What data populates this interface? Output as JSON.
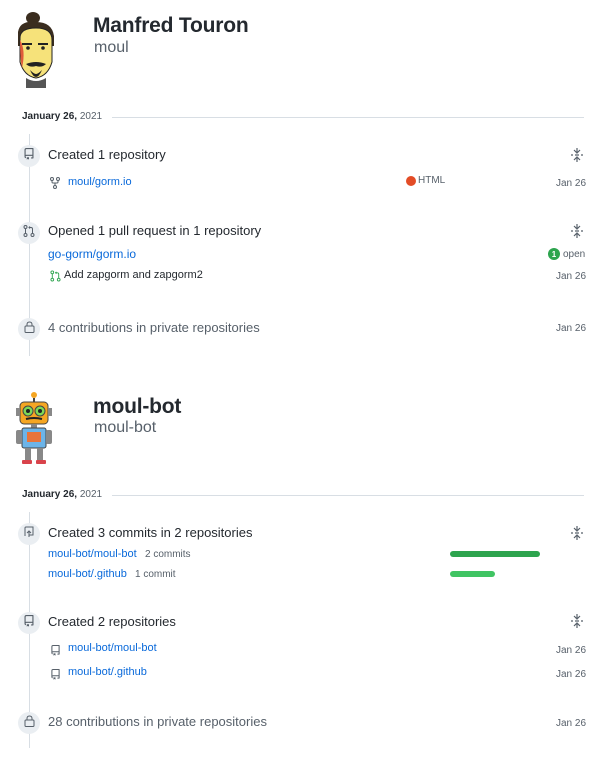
{
  "users": [
    {
      "name": "Manfred Touron",
      "login": "moul",
      "date": {
        "day": "January 26,",
        "year": "2021"
      },
      "events": {
        "created_repo": {
          "title": "Created 1 repository",
          "repo": "moul/gorm.io",
          "language": "HTML",
          "language_color": "#e34c26",
          "date": "Jan 26"
        },
        "pull_request": {
          "title": "Opened 1 pull request in 1 repository",
          "repo": "go-gorm/gorm.io",
          "open_count": "1",
          "open_label": "open",
          "pr_title": "Add zapgorm and zapgorm2",
          "date": "Jan 26"
        },
        "private": {
          "title": "4 contributions in private repositories",
          "date": "Jan 26"
        }
      }
    },
    {
      "name": "moul-bot",
      "login": "moul-bot",
      "date": {
        "day": "January 26,",
        "year": "2021"
      },
      "events": {
        "commits": {
          "title": "Created 3 commits in 2 repositories",
          "items": [
            {
              "repo": "moul-bot/moul-bot",
              "count": "2 commits",
              "fraction": 1.0
            },
            {
              "repo": "moul-bot/.github",
              "count": "1 commit",
              "fraction": 0.5
            }
          ]
        },
        "created_repos": {
          "title": "Created 2 repositories",
          "items": [
            {
              "repo": "moul-bot/moul-bot",
              "date": "Jan 26"
            },
            {
              "repo": "moul-bot/.github",
              "date": "Jan 26"
            }
          ]
        },
        "private": {
          "title": "28 contributions in private repositories",
          "date": "Jan 26"
        }
      }
    }
  ],
  "colors": {
    "link": "#0969da",
    "bar_dark": "#2da44e",
    "bar_light": "#40c463",
    "open_green": "#2da44e",
    "timeline": "#d8dee4"
  },
  "icons": {
    "repo": "repo-icon",
    "fork": "repo-forked-icon",
    "pull_request": "git-pull-request-icon",
    "lock": "lock-icon",
    "push": "repo-push-icon",
    "unfold": "unfold-icon"
  }
}
